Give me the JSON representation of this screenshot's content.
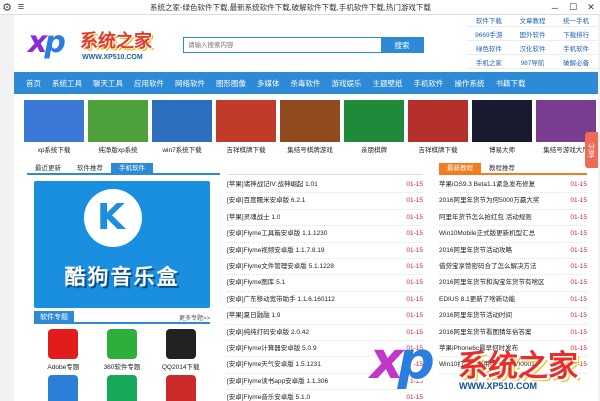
{
  "window": {
    "title": "系统之家-绿色软件下载,最新系统软件下载,破解软件下载,手机软件下载,热门游戏下载"
  },
  "logo": {
    "xp": "xp",
    "brand": "系统之家",
    "domain": "WWW.XP510.COM"
  },
  "search": {
    "placeholder": "请输入搜索内容",
    "button": "搜索"
  },
  "toplinks": [
    "软件下载",
    "文章教程",
    "统一手机",
    "9669手游",
    "国外软件",
    "下载排行",
    "绿色软件",
    "汉化软件",
    "手机软件",
    "手机之家",
    "987导航",
    "破解必备"
  ],
  "nav": [
    "首页",
    "系统工具",
    "聊天工具",
    "应用软件",
    "网络软件",
    "图形图像",
    "多媒体",
    "杀毒软件",
    "游戏娱乐",
    "主题壁纸",
    "手机软件",
    "操作系统",
    "书籍下载"
  ],
  "banner": [
    {
      "cap": "xp系统下载",
      "color": "#3b78d8"
    },
    {
      "cap": "纯净版xp系统",
      "color": "#4fa13c"
    },
    {
      "cap": "win7系统下载",
      "color": "#2c6fbf"
    },
    {
      "cap": "吉祥棋牌下载",
      "color": "#c23b2a"
    },
    {
      "cap": "集结号棋牌游戏",
      "color": "#8f4b1d"
    },
    {
      "cap": "亲朋棋牌",
      "color": "#1f8a3a"
    },
    {
      "cap": "吉祥棋牌下载",
      "color": "#b5302a"
    },
    {
      "cap": "博易大师",
      "color": "#1a1a2e"
    },
    {
      "cap": "集结号游戏大厅",
      "color": "#7a3c8e"
    }
  ],
  "share": {
    "label": "分享"
  },
  "left": {
    "tabs": [
      "最近更新",
      "软件推荐",
      "手机软件"
    ],
    "active_tab": 2,
    "feature": {
      "name": "酷狗音乐盒",
      "letter": "K"
    },
    "section": {
      "label": "软件专题",
      "more": "更多专题>>"
    },
    "apps": [
      {
        "label": "Adobe专题",
        "color": "#e21b1b",
        "name": "adobe-icon"
      },
      {
        "label": "360软件专题",
        "color": "#2eae3a",
        "name": "360-icon"
      },
      {
        "label": "QQ2014下载",
        "color": "#222222",
        "name": "qq-icon"
      },
      {
        "label": "",
        "color": "#2c7fd6",
        "name": "app-icon-4"
      },
      {
        "label": "",
        "color": "#17a85b",
        "name": "app-icon-5"
      },
      {
        "label": "",
        "color": "#cc2b2b",
        "name": "app-icon-6"
      }
    ]
  },
  "middle": {
    "list": [
      {
        "t": "[苹果]诸神战记IV:战神崛起 1.01",
        "d": "01-15"
      },
      {
        "t": "[安卓]百度糯米安卓版 6.2.1",
        "d": "01-15"
      },
      {
        "t": "[苹果]灵魂战士 1.0",
        "d": "01-15"
      },
      {
        "t": "[安卓]Flyme工具箱安卓版 1.1.1230",
        "d": "01-15"
      },
      {
        "t": "[安卓]Flyme视频安卓版 1.1.7.8.19",
        "d": "01-15"
      },
      {
        "t": "[安卓]Flyme文件管理安卓版 5.1.1228",
        "d": "01-15"
      },
      {
        "t": "[安卓]Flyme图库 5.1",
        "d": "01-15"
      },
      {
        "t": "[安卓]广东移动宽带助手 1.1.6.160112",
        "d": "01-15"
      },
      {
        "t": "[苹果]夏日融融 1.9",
        "d": "01-15"
      },
      {
        "t": "[安卓]纯纯打码安卓版 2.0.42",
        "d": "01-15"
      },
      {
        "t": "[安卓]Flyme计算器安卓版 5.0.9",
        "d": "01-15"
      },
      {
        "t": "[安卓]Flyme天气安卓版 1.5.1231",
        "d": "01-15"
      },
      {
        "t": "[安卓]Flyme读书app安卓版 1.1.306",
        "d": "01-15"
      },
      {
        "t": "[安卓]Flyme音乐安卓版 5.1.0",
        "d": "01-15"
      }
    ]
  },
  "right": {
    "tabs": [
      "最新教程",
      "教程推荐"
    ],
    "active_tab": 0,
    "list": [
      {
        "t": "苹果iOS9.3 Beta1.1紧急发布修复",
        "d": "01-15"
      },
      {
        "t": "2016阿里年货节为何5000万赢大奖",
        "d": "01-15"
      },
      {
        "t": "阿里年货节怎么抢红包 活动规则",
        "d": "01-15"
      },
      {
        "t": "Win10Mobile正式版更新机型汇总",
        "d": "01-15"
      },
      {
        "t": "2016阿里年货节活动攻略",
        "d": "01-15"
      },
      {
        "t": "借贷宝享赞密码合了怎么解决方法",
        "d": "01-15"
      },
      {
        "t": "2016阿里年货节和淘宝年货节有啥区",
        "d": "01-15"
      },
      {
        "t": "EDIUS 8.1更新了啥新功能",
        "d": "01-15"
      },
      {
        "t": "2016阿里年货节活动时间",
        "d": "01-15"
      },
      {
        "t": "2016阿里年货节看图猜年俗答案",
        "d": "01-15"
      },
      {
        "t": "苹果iPhone6c最早何时发布",
        "d": "01-15"
      },
      {
        "t": "Win10打不开应用提示0xc000001",
        "d": "01-15"
      }
    ]
  }
}
